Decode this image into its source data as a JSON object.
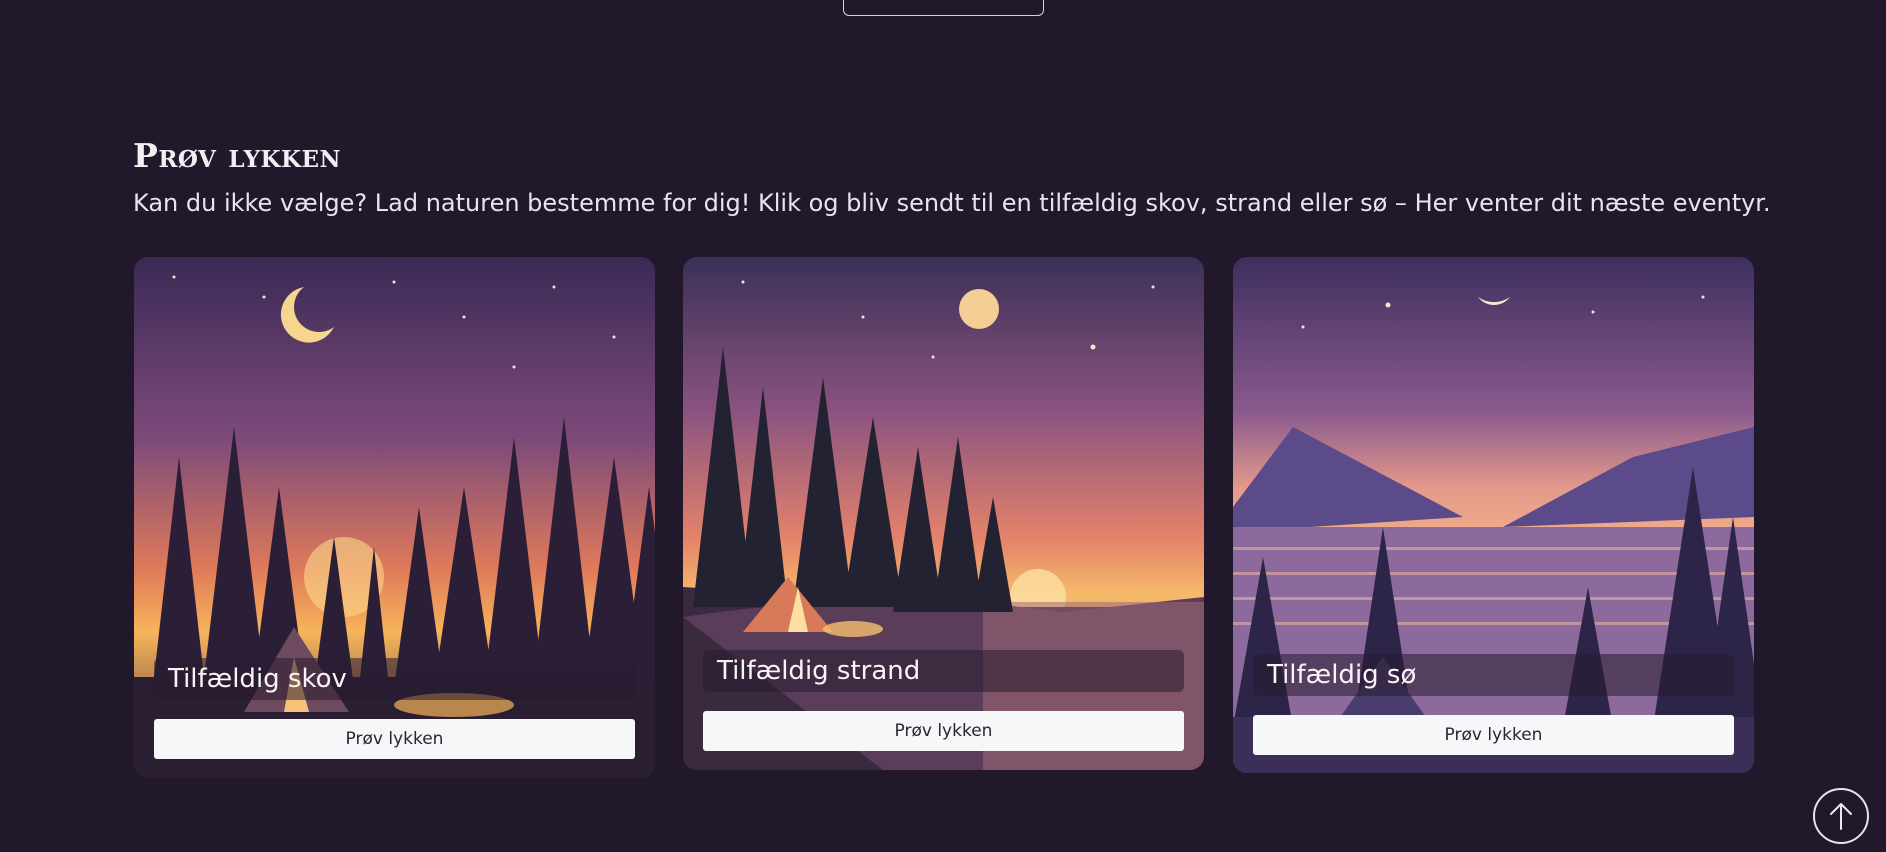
{
  "section": {
    "title": "Prøv lykken",
    "description": "Kan du ikke vælge? Lad naturen bestemme for dig! Klik og bliv sendt til en tilfældig skov, strand eller sø – Her venter dit næste eventyr."
  },
  "cards": [
    {
      "label": "Tilfældig skov",
      "button_label": "Prøv lykken",
      "image": "forest-camp-night-illustration"
    },
    {
      "label": "Tilfældig strand",
      "button_label": "Prøv lykken",
      "image": "beach-camp-sunset-illustration"
    },
    {
      "label": "Tilfældig sø",
      "button_label": "Prøv lykken",
      "image": "lake-camp-dusk-illustration"
    }
  ],
  "icons": {
    "scroll_top": "arrow-up-icon"
  },
  "colors": {
    "background": "#21192b",
    "button": "#f6f7f9",
    "sky_top": "#3a2a55",
    "sunset": "#f4a24a"
  }
}
